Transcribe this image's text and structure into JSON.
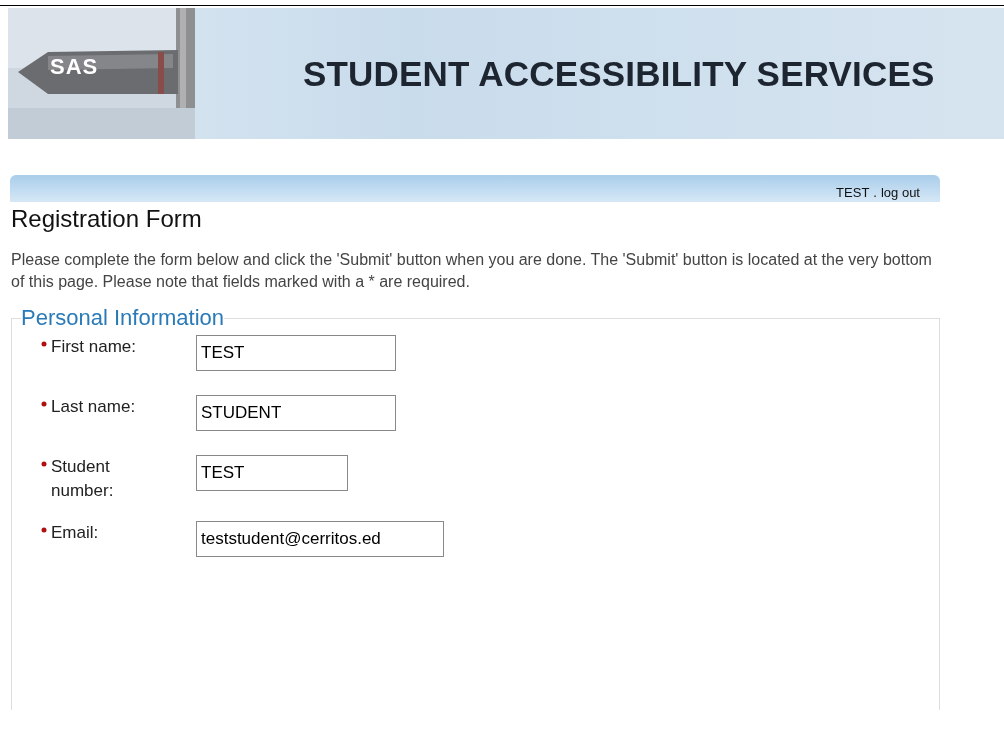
{
  "banner": {
    "logo_text": "SAS",
    "title": "STUDENT ACCESSIBILITY SERVICES"
  },
  "user_bar": {
    "user": "TEST",
    "separator": ".",
    "logout": "log out"
  },
  "heading": "Registration Form",
  "intro": "Please complete the form below and click the 'Submit' button when you are done. The 'Submit' button is located at the very bottom of this page. Please note that fields marked with a * are required.",
  "section": {
    "legend": "Personal Information",
    "fields": [
      {
        "label": "First name:",
        "value": "TEST",
        "required": true
      },
      {
        "label": "Last name:",
        "value": "STUDENT",
        "required": true
      },
      {
        "label": "Student number:",
        "value": "TEST",
        "required": true
      },
      {
        "label": "Email:",
        "value": "teststudent@cerritos.ed",
        "required": true
      }
    ]
  }
}
